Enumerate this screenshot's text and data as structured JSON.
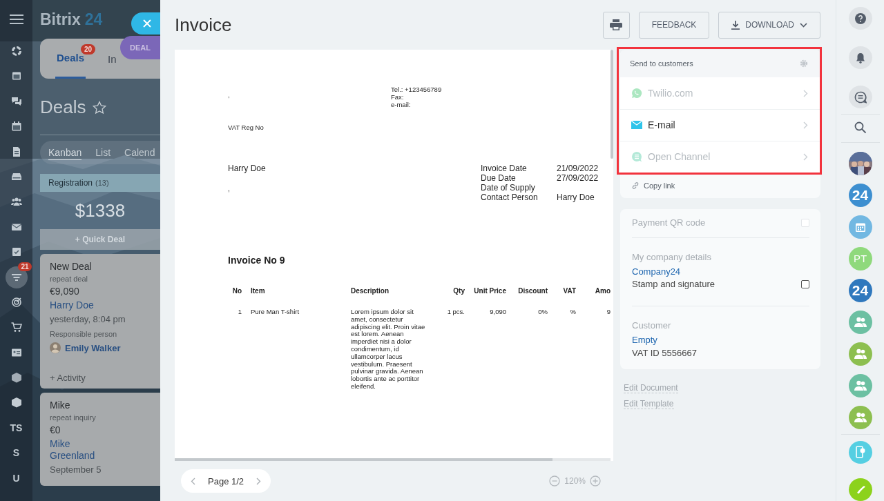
{
  "left_rail": {
    "items": [
      {
        "kind": "icon",
        "selected": false
      },
      {
        "kind": "icon",
        "selected": false
      },
      {
        "kind": "icon",
        "selected": false
      },
      {
        "kind": "icon",
        "selected": false
      },
      {
        "kind": "icon",
        "selected": false
      },
      {
        "kind": "icon",
        "selected": false
      },
      {
        "kind": "icon",
        "selected": false
      },
      {
        "kind": "icon",
        "selected": false
      },
      {
        "kind": "icon",
        "selected": false
      },
      {
        "kind": "icon",
        "selected": true,
        "badge": "21"
      },
      {
        "kind": "icon",
        "selected": false
      },
      {
        "kind": "icon",
        "selected": false
      },
      {
        "kind": "icon",
        "selected": false
      },
      {
        "kind": "icon",
        "selected": false
      },
      {
        "kind": "icon",
        "selected": false
      },
      {
        "kind": "text",
        "label": "TS",
        "selected": false
      },
      {
        "kind": "text",
        "label": "S",
        "selected": false
      },
      {
        "kind": "text",
        "label": "U",
        "selected": false
      }
    ]
  },
  "crm": {
    "logo": {
      "name": "Bitrix",
      "number": "24"
    },
    "tabs": [
      {
        "label": "Deals",
        "badge": "20",
        "selected": true
      },
      {
        "label": "In",
        "selected": false
      }
    ],
    "deal_pill": "DEAL",
    "title": "Deals",
    "favorite": false,
    "views": [
      {
        "label": "Kanban",
        "selected": true
      },
      {
        "label": "List",
        "selected": false
      },
      {
        "label": "Calend",
        "selected": false
      }
    ],
    "stage": {
      "name": "Registration",
      "count": "(13)",
      "total": "$1338",
      "quick_deal": "+ Quick Deal"
    },
    "cards": [
      {
        "title": "New Deal",
        "subtitle": "repeat deal",
        "amount": "€9,090",
        "contact": "Harry Doe",
        "date": "yesterday, 8:04 pm",
        "responsible_label": "Responsible person",
        "responsible": "Emily Walker",
        "activity": "+ Activity"
      },
      {
        "title": "Mike",
        "subtitle": "repeat inquiry",
        "amount": "€0",
        "contact": "Mike Greenland",
        "date": "September 5"
      }
    ]
  },
  "invoice": {
    "title": "Invoice",
    "feedback": "FEEDBACK",
    "download": "DOWNLOAD",
    "document": {
      "seller_mark": ",",
      "contacts": [
        "Tel.: +123456789",
        "Fax:",
        "e-mail:"
      ],
      "vat_reg": "VAT Reg No",
      "buyer": "Harry Doe",
      "buyer_mark": ",",
      "details": [
        {
          "label": "Invoice Date",
          "value": "21/09/2022"
        },
        {
          "label": "Due Date",
          "value": "27/09/2022"
        },
        {
          "label": "Date of Supply"
        },
        {
          "label": "Contact Person",
          "value": "Harry Doe"
        }
      ],
      "heading": "Invoice No 9",
      "table": {
        "columns": [
          "No",
          "Item",
          "Description",
          "Qty",
          "Unit Price",
          "Discount",
          "VAT",
          "Amo"
        ],
        "rows": [
          [
            "1",
            "Pure Man T-shirt",
            "Lorem ipsum dolor sit amet, consectetur adipiscing elit. Proin vitae est lorem. Aenean imperdiet nisi a dolor condimentum, id ullamcorper lacus vestibulum. Praesent pulvinar gravida. Aenean lobortis ante ac porttitor eleifend.",
            "1 pcs.",
            "9,090",
            "0%",
            "%",
            "9"
          ]
        ]
      }
    },
    "pager": "Page 1/2",
    "zoom": "120%"
  },
  "send": {
    "title": "Send to customers",
    "channels": [
      {
        "kind": "whatsapp",
        "label": "Twilio.com",
        "disabled": true
      },
      {
        "kind": "email",
        "label": "E-mail",
        "disabled": false
      },
      {
        "kind": "openchannel",
        "label": "Open Channel",
        "disabled": true
      }
    ],
    "copy_link": "Copy link"
  },
  "options": {
    "payment_qr": {
      "label": "Payment QR code",
      "checked": false,
      "disabled": true
    },
    "company": {
      "label": "My company details",
      "name": "Company24",
      "stamp": {
        "label": "Stamp and signature",
        "checked": false,
        "disabled": false
      }
    },
    "customer": {
      "label": "Customer",
      "name": "Empty",
      "vat": "VAT ID 5556667"
    }
  },
  "edit_links": [
    "Edit Document",
    "Edit Template"
  ],
  "right_rail": {
    "contacts": [
      {
        "kind": "picture",
        "color": "#5a6f9a"
      },
      {
        "kind": "logo",
        "label": "24",
        "color": "#3d8fd0"
      },
      {
        "kind": "calendar",
        "color": "#72b8e2"
      },
      {
        "kind": "initials",
        "label": "PT",
        "color": "#8fd97c"
      },
      {
        "kind": "logo",
        "label": "24",
        "color": "#2f78bd"
      },
      {
        "kind": "group",
        "color": "#6cc0a2"
      },
      {
        "kind": "group",
        "color": "#8dbf50"
      },
      {
        "kind": "group",
        "color": "#6cc0a2"
      },
      {
        "kind": "group",
        "color": "#8dbf50"
      }
    ]
  }
}
